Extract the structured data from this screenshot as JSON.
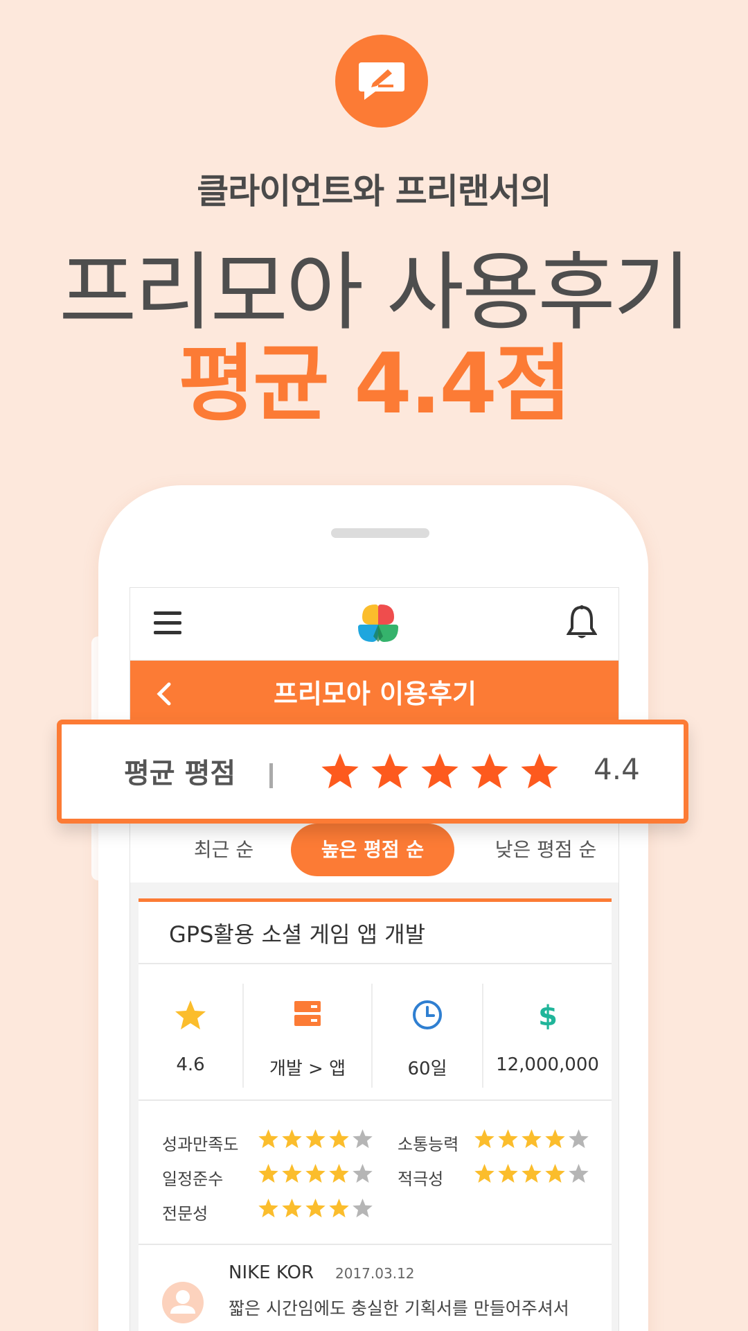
{
  "promo": {
    "subtitle": "클라이언트와 프리랜서의",
    "headline": "프리모아 사용후기",
    "score_line": "평균 4.4점",
    "icon": "chat-edit-icon"
  },
  "app": {
    "header_title": "프리모아 이용후기",
    "icons": {
      "menu": "hamburger-icon",
      "logo": "clover-logo",
      "notification": "bell-icon",
      "back": "chevron-left-icon"
    }
  },
  "banner": {
    "label": "평균 평점",
    "separator": "|",
    "stars": 5,
    "score": "4.4"
  },
  "sort_tabs": [
    {
      "label": "최근 순",
      "active": false
    },
    {
      "label": "높은 평점 순",
      "active": true
    },
    {
      "label": "낮은 평점 순",
      "active": false
    }
  ],
  "review_card": {
    "project_title": "GPS활용 소셜 게임 앱 개발",
    "stats": [
      {
        "icon": "star-icon",
        "value": "4.6"
      },
      {
        "icon": "server-icon",
        "value": "개발 > 앱"
      },
      {
        "icon": "clock-icon",
        "value": "60일"
      },
      {
        "icon": "dollar-icon",
        "value": "12,000,000"
      }
    ],
    "ratings": [
      {
        "label": "성과만족도",
        "stars": 4
      },
      {
        "label": "소통능력",
        "stars": 4
      },
      {
        "label": "일정준수",
        "stars": 4
      },
      {
        "label": "적극성",
        "stars": 4
      },
      {
        "label": "전문성",
        "stars": 4
      }
    ],
    "reviewer": {
      "name": "NIKE KOR",
      "date": "2017.03.12",
      "text": "짧은 시간임에도 충실한 기획서를 만들어주셔서 감사합니다. 감사합니다 감사합니다"
    }
  },
  "colors": {
    "accent": "#fc7b35",
    "background": "#fde8dc",
    "star_filled": "#fbbd2c",
    "star_empty": "#b5b5b5",
    "banner_star": "#fd5a1e"
  }
}
